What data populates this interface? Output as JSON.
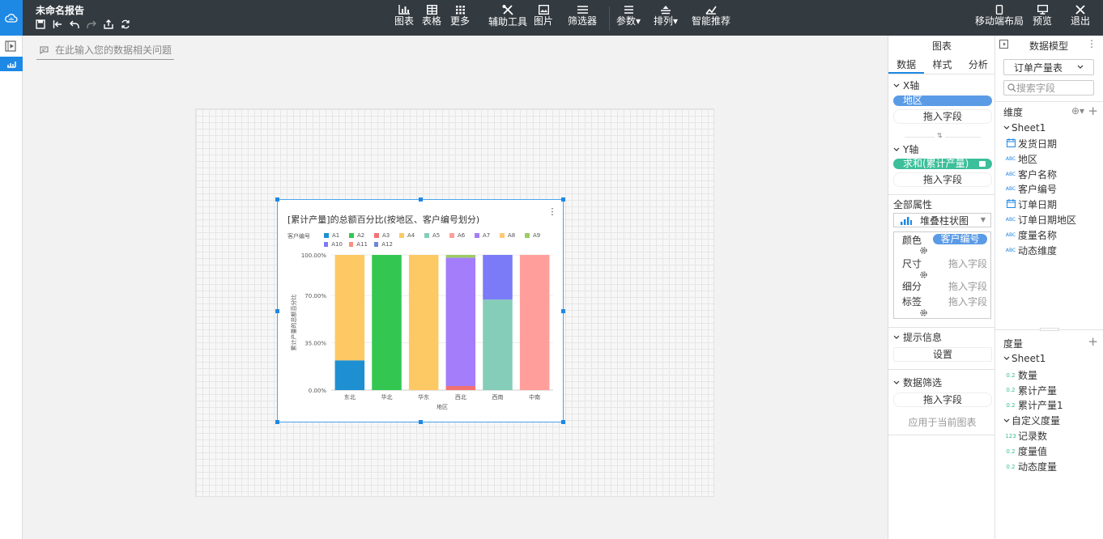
{
  "app": {
    "report_title": "未命名报告"
  },
  "toolbar": {
    "chart": "图表",
    "table": "表格",
    "more": "更多",
    "aux_tools": "辅助工具",
    "image": "图片",
    "filter": "筛选器",
    "params": "参数",
    "arrange": "排列",
    "smart_recommend": "智能推荐",
    "mobile_layout": "移动端布局",
    "preview": "预览",
    "exit": "退出"
  },
  "ask": {
    "placeholder": "在此输入您的数据相关问题"
  },
  "chart_widget": {
    "title": "[累计产量]的总额百分比(按地区、客户编号划分)",
    "legend_title": "客户编号"
  },
  "chart_data": {
    "type": "bar",
    "stacked": true,
    "percent": true,
    "title": "[累计产量]的总额百分比(按地区、客户编号划分)",
    "xlabel": "地区",
    "ylabel": "累计产量的总额百分比",
    "categories": [
      "东北",
      "华北",
      "华东",
      "西北",
      "西南",
      "中南"
    ],
    "y_ticks": [
      "0.00%",
      "35.00%",
      "70.00%",
      "100.00%"
    ],
    "ylim": [
      0,
      100
    ],
    "legend_placement": "top",
    "series": [
      {
        "name": "A1",
        "color": "#1e90d2",
        "values": [
          22,
          0,
          0,
          0,
          0,
          0
        ]
      },
      {
        "name": "A2",
        "color": "#33c752",
        "values": [
          0,
          100,
          0,
          0,
          0,
          0
        ]
      },
      {
        "name": "A3",
        "color": "#f27272",
        "values": [
          0,
          0,
          0,
          3,
          0,
          0
        ]
      },
      {
        "name": "A4",
        "color": "#fdc965",
        "values": [
          78,
          0,
          100,
          0,
          0,
          0
        ]
      },
      {
        "name": "A5",
        "color": "#85cdb9",
        "values": [
          0,
          0,
          0,
          0,
          67,
          0
        ]
      },
      {
        "name": "A6",
        "color": "#ff9e9a",
        "values": [
          0,
          0,
          0,
          0,
          0,
          100
        ]
      },
      {
        "name": "A7",
        "color": "#a47dfa",
        "values": [
          0,
          0,
          0,
          95,
          0,
          0
        ]
      },
      {
        "name": "A8",
        "color": "#fdca76",
        "values": [
          0,
          0,
          0,
          0,
          0,
          0
        ]
      },
      {
        "name": "A9",
        "color": "#9ccc65",
        "values": [
          0,
          0,
          0,
          2,
          0,
          0
        ]
      },
      {
        "name": "A10",
        "color": "#7b7bf8",
        "values": [
          0,
          0,
          0,
          0,
          33,
          0
        ]
      },
      {
        "name": "A11",
        "color": "#fb8f7f",
        "values": [
          0,
          0,
          0,
          0,
          0,
          0
        ]
      },
      {
        "name": "A12",
        "color": "#6f86d9",
        "values": [
          0,
          0,
          0,
          0,
          0,
          0
        ]
      }
    ]
  },
  "panel1": {
    "header": "图表",
    "tabs": [
      "数据",
      "样式",
      "分析"
    ],
    "x_axis": "X轴",
    "x_field": "地区",
    "drop_hint": "拖入字段",
    "y_axis": "Y轴",
    "y_field": "求和(累计产量)",
    "all_props": "全部属性",
    "chart_type": "堆叠柱状图",
    "color": "颜色",
    "color_field": "客户编号",
    "size": "尺寸",
    "detail": "细分",
    "label": "标签",
    "tooltip": "提示信息",
    "settings": "设置",
    "data_filter": "数据筛选",
    "apply_current": "应用于当前图表"
  },
  "panel2": {
    "header": "数据模型",
    "dataset": "订单产量表",
    "search_placeholder": "搜索字段",
    "dim_title": "维度",
    "sheet": "Sheet1",
    "dimensions": [
      {
        "icon": "calendar-icon",
        "label": "发货日期"
      },
      {
        "icon": "abc-icon",
        "label": "地区"
      },
      {
        "icon": "abc-icon",
        "label": "客户名称"
      },
      {
        "icon": "abc-icon",
        "label": "客户编号"
      },
      {
        "icon": "calendar-icon",
        "label": "订单日期"
      },
      {
        "icon": "abc-icon",
        "label": "订单日期地区"
      },
      {
        "icon": "abc-icon",
        "label": "度量名称"
      },
      {
        "icon": "abc-icon",
        "label": "动态维度"
      }
    ],
    "measure_title": "度量",
    "sheet2": "Sheet1",
    "measures": [
      {
        "icon": "0.2",
        "label": "数量"
      },
      {
        "icon": "0.2",
        "label": "累计产量"
      },
      {
        "icon": "0.2",
        "label": "累计产量1"
      }
    ],
    "custom_measure": "自定义度量",
    "custom_measures": [
      {
        "icon": "123",
        "label": "记录数"
      },
      {
        "icon": "0.2",
        "label": "度量值"
      },
      {
        "icon": "0.2",
        "label": "动态度量"
      }
    ]
  }
}
